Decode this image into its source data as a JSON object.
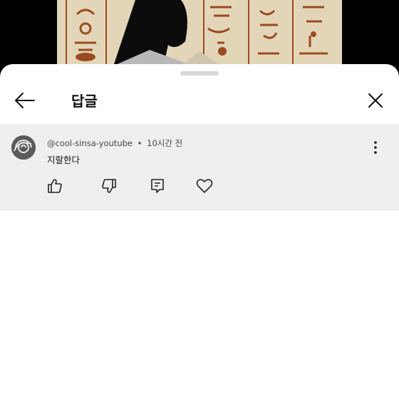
{
  "sheet": {
    "title": "답글",
    "icons": {
      "back": "arrow-left-icon",
      "close": "close-icon"
    }
  },
  "comment": {
    "author": "@cool-sinsa-youtube",
    "separator": "•",
    "time": "10시간 전",
    "text": "지랄한다",
    "actions": [
      "like",
      "dislike",
      "reply",
      "heart"
    ],
    "icons": {
      "more": "more-vertical-icon",
      "like": "thumb-up-icon",
      "dislike": "thumb-down-icon",
      "reply": "reply-icon",
      "heart": "heart-icon"
    }
  },
  "colors": {
    "sheet_bg": "#ffffff",
    "comment_bg": "#efefef",
    "text": "#111111",
    "video_bg": "#000000"
  }
}
